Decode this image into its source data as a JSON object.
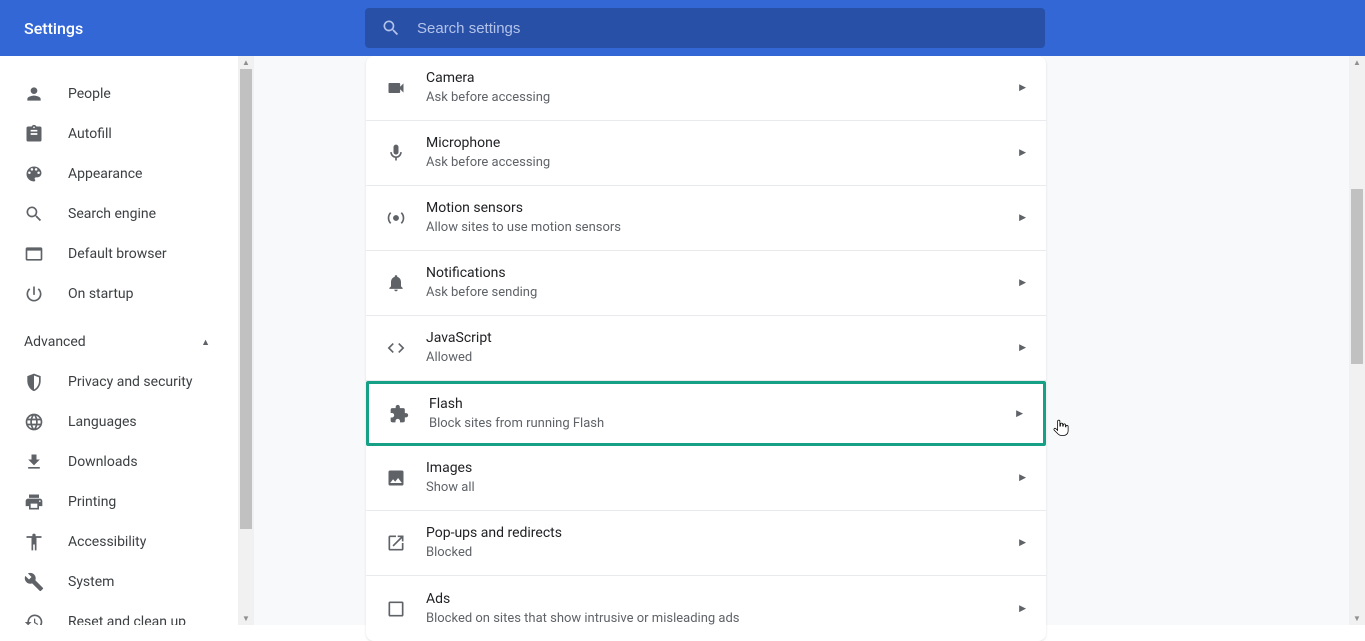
{
  "header": {
    "title": "Settings",
    "search_placeholder": "Search settings"
  },
  "sidebar": {
    "items": [
      {
        "icon": "person",
        "label": "People"
      },
      {
        "icon": "assignment",
        "label": "Autofill"
      },
      {
        "icon": "palette",
        "label": "Appearance"
      },
      {
        "icon": "search",
        "label": "Search engine"
      },
      {
        "icon": "browser",
        "label": "Default browser"
      },
      {
        "icon": "power",
        "label": "On startup"
      }
    ],
    "advanced_label": "Advanced",
    "advanced_items": [
      {
        "icon": "security",
        "label": "Privacy and security"
      },
      {
        "icon": "language",
        "label": "Languages"
      },
      {
        "icon": "download",
        "label": "Downloads"
      },
      {
        "icon": "print",
        "label": "Printing"
      },
      {
        "icon": "accessibility",
        "label": "Accessibility"
      },
      {
        "icon": "build",
        "label": "System"
      },
      {
        "icon": "restore",
        "label": "Reset and clean up"
      }
    ]
  },
  "content": {
    "rows": [
      {
        "icon": "videocam",
        "title": "Camera",
        "subtitle": "Ask before accessing",
        "highlight": false
      },
      {
        "icon": "mic",
        "title": "Microphone",
        "subtitle": "Ask before accessing",
        "highlight": false
      },
      {
        "icon": "sensors",
        "title": "Motion sensors",
        "subtitle": "Allow sites to use motion sensors",
        "highlight": false
      },
      {
        "icon": "notifications",
        "title": "Notifications",
        "subtitle": "Ask before sending",
        "highlight": false
      },
      {
        "icon": "code",
        "title": "JavaScript",
        "subtitle": "Allowed",
        "highlight": false
      },
      {
        "icon": "extension",
        "title": "Flash",
        "subtitle": "Block sites from running Flash",
        "highlight": true
      },
      {
        "icon": "image",
        "title": "Images",
        "subtitle": "Show all",
        "highlight": false
      },
      {
        "icon": "launch",
        "title": "Pop-ups and redirects",
        "subtitle": "Blocked",
        "highlight": false
      },
      {
        "icon": "ads",
        "title": "Ads",
        "subtitle": "Blocked on sites that show intrusive or misleading ads",
        "highlight": false
      }
    ]
  }
}
